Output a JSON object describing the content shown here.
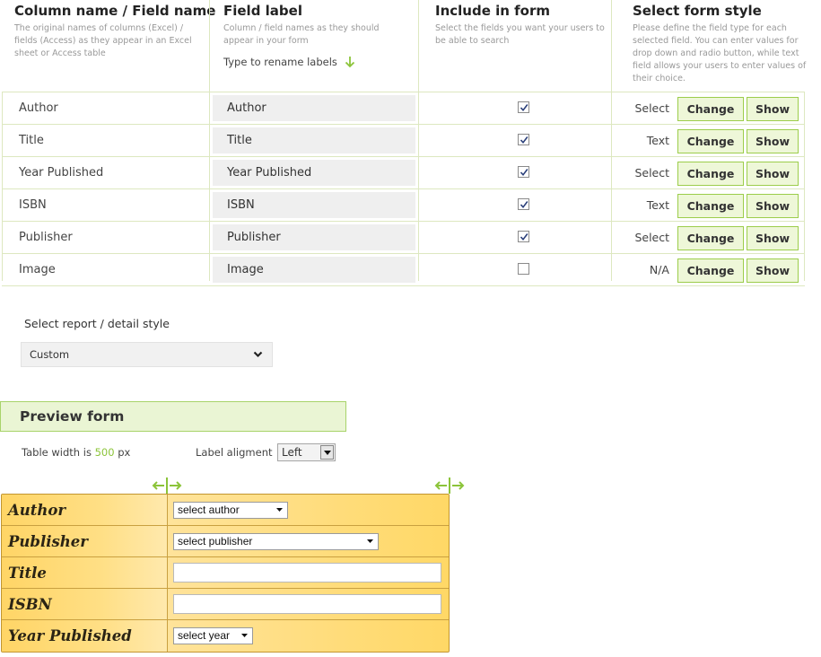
{
  "headers": [
    {
      "title": "Column name / Field name",
      "desc": "The original names of columns (Excel) / fields (Access) as they appear in an Excel sheet or Access table"
    },
    {
      "title": "Field label",
      "desc": "Column / field names as they should appear in your form",
      "hint": "Type to rename labels"
    },
    {
      "title": "Include in form",
      "desc": "Select the fields you want your users to be able to search"
    },
    {
      "title": "Select form style",
      "desc": "Please define the field type for each selected field. You can enter values for drop down and radio button, while text field allows your users to enter values of their choice."
    }
  ],
  "rows": [
    {
      "name": "Author",
      "label": "Author",
      "included": true,
      "style": "Select"
    },
    {
      "name": "Title",
      "label": "Title",
      "included": true,
      "style": "Text"
    },
    {
      "name": "Year Published",
      "label": "Year Published",
      "included": true,
      "style": "Select"
    },
    {
      "name": "ISBN",
      "label": "ISBN",
      "included": true,
      "style": "Text"
    },
    {
      "name": "Publisher",
      "label": "Publisher",
      "included": true,
      "style": "Select"
    },
    {
      "name": "Image",
      "label": "Image",
      "included": false,
      "style": "N/A"
    }
  ],
  "buttons": {
    "change": "Change",
    "show": "Show"
  },
  "report": {
    "label": "Select report / detail style",
    "value": "Custom"
  },
  "preview": {
    "title": "Preview form",
    "table_width_prefix": "Table width is",
    "table_width_value": "500",
    "table_width_unit": "px",
    "label_alignment_label": "Label aligment",
    "label_alignment_value": "Left",
    "fields": [
      {
        "label": "Author",
        "type": "select",
        "value": "select author"
      },
      {
        "label": "Publisher",
        "type": "select",
        "value": "select publisher"
      },
      {
        "label": "Title",
        "type": "text",
        "value": ""
      },
      {
        "label": "ISBN",
        "type": "text",
        "value": ""
      },
      {
        "label": "Year Published",
        "type": "select",
        "value": "select year"
      }
    ]
  },
  "colors": {
    "accent_green": "#8cc43a",
    "button_border": "#9ccd4b",
    "preview_gold": "#ffd566"
  },
  "icons": {
    "hint_arrow": "arrow-down-icon",
    "dropdown": "chevron-down-icon",
    "resize": "resize-horizontal-icon",
    "check": "check-icon"
  }
}
